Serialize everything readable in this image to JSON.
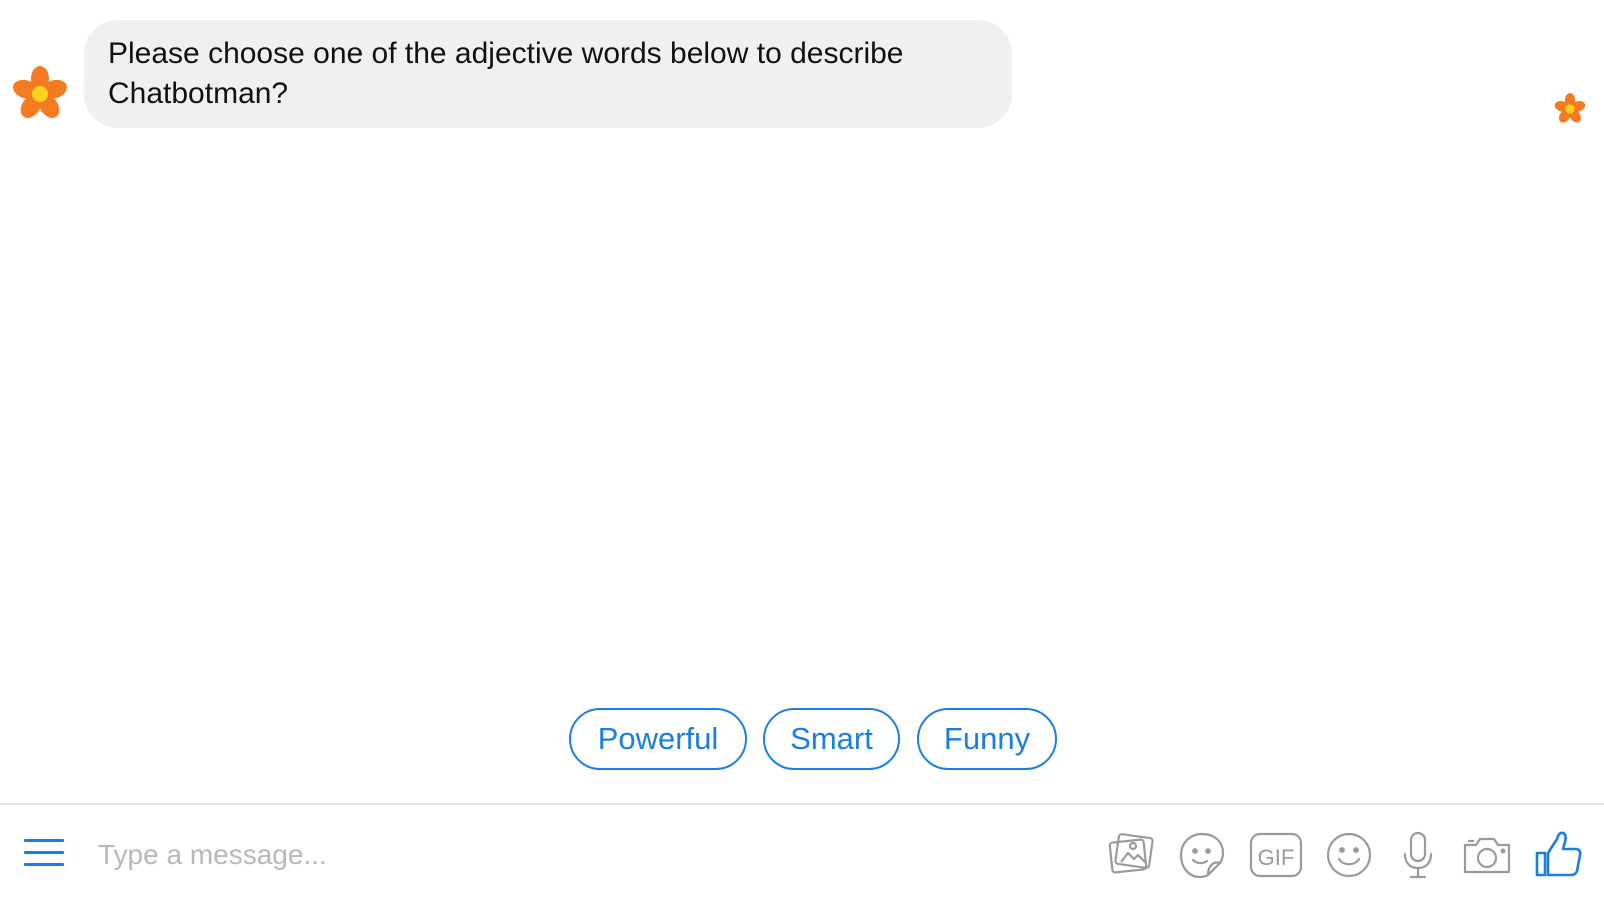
{
  "conversation": {
    "bot_avatar": "flower-icon",
    "messages": [
      {
        "sender": "bot",
        "text_line1": "Please choose one of the adjective words below to describe",
        "text_line2": "Chatbotman?"
      }
    ],
    "read_receipt_icon": "flower-icon"
  },
  "quick_replies": [
    {
      "label": "Powerful"
    },
    {
      "label": "Smart"
    },
    {
      "label": "Funny"
    }
  ],
  "composer": {
    "menu_icon": "hamburger-menu-icon",
    "placeholder": "Type a message...",
    "tools": [
      {
        "icon": "photo-icon"
      },
      {
        "icon": "sticker-icon"
      },
      {
        "icon": "gif-icon",
        "text": "GIF"
      },
      {
        "icon": "emoji-icon"
      },
      {
        "icon": "microphone-icon"
      },
      {
        "icon": "camera-icon"
      },
      {
        "icon": "thumbs-up-icon"
      }
    ]
  },
  "colors": {
    "accent": "#1a7fe0",
    "bubble_bg": "#f0f0f0",
    "icon_gray": "#9a9a9a",
    "flower_petal": "#f47b20",
    "flower_center": "#ffd21f"
  }
}
